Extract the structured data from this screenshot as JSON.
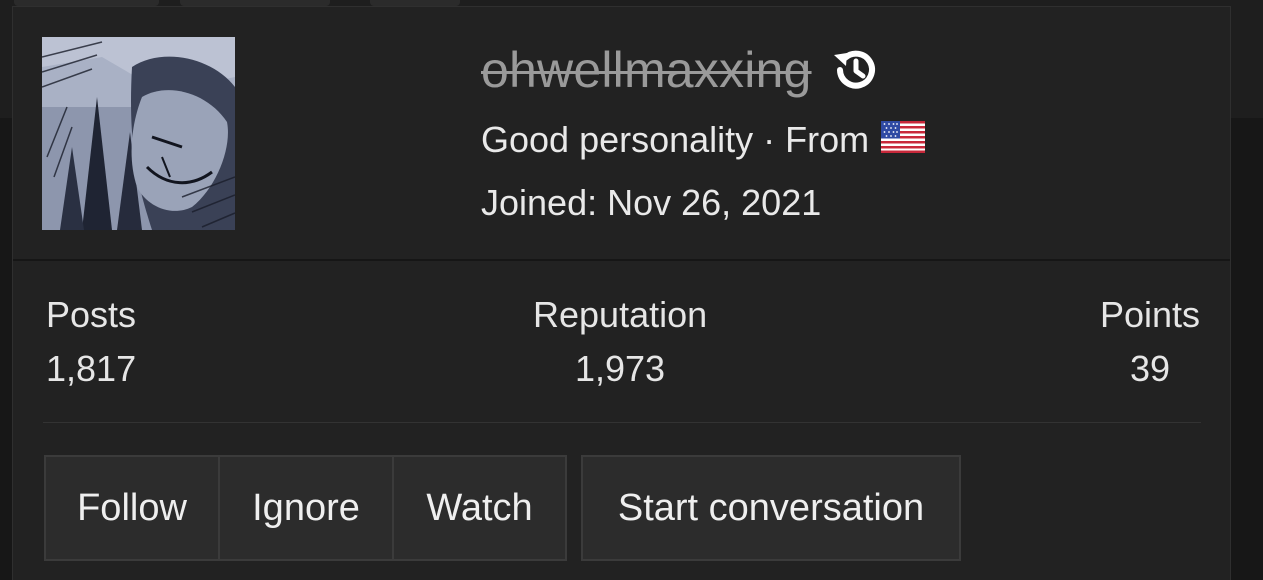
{
  "profile": {
    "username": "ohwellmaxxing",
    "title_text": "Good personality · From",
    "flag": "us-flag",
    "joined": "Joined: Nov 26, 2021"
  },
  "stats": {
    "posts_label": "Posts",
    "posts_value": "1,817",
    "reputation_label": "Reputation",
    "reputation_value": "1,973",
    "points_label": "Points",
    "points_value": "39"
  },
  "actions": {
    "follow_label": "Follow",
    "ignore_label": "Ignore",
    "watch_label": "Watch",
    "start_conversation_label": "Start conversation"
  },
  "colors": {
    "card_bg": "#222222",
    "username_struck": "#9a9a9a",
    "text": "#e9e9e9",
    "button_bg": "#2c2c2c"
  }
}
